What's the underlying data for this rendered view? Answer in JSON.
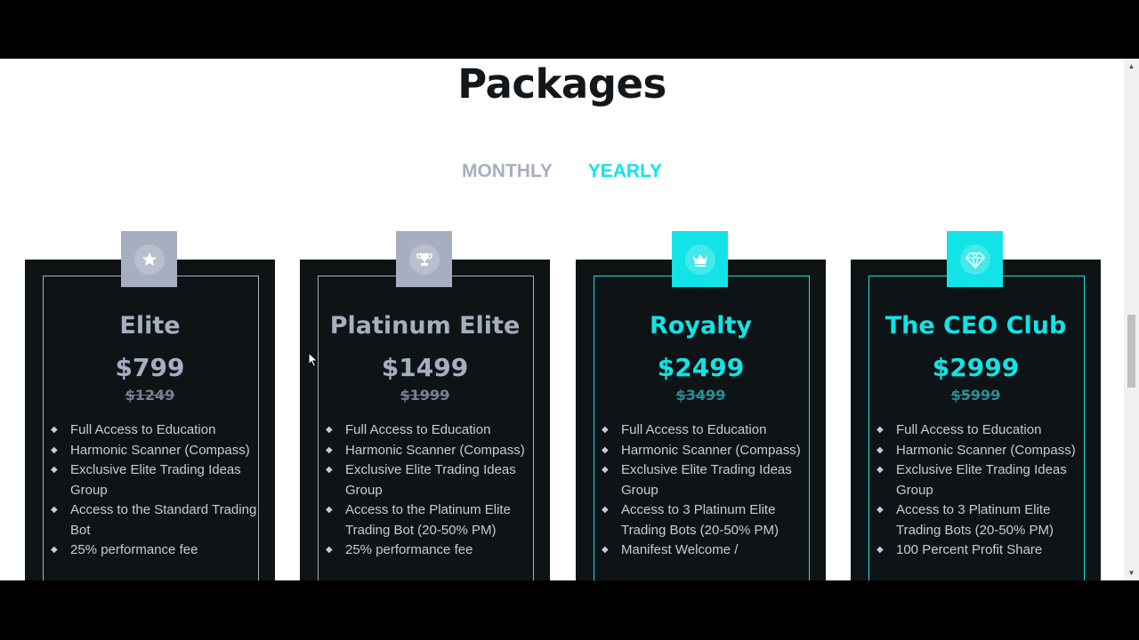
{
  "page": {
    "title": "Packages"
  },
  "billing_toggle": {
    "monthly": "MONTHLY",
    "yearly": "YEARLY",
    "selected": "yearly"
  },
  "colors": {
    "accent": "#11e3e6",
    "muted": "#a7aec0",
    "card_bg": "#0e1416"
  },
  "plans": [
    {
      "name": "Elite",
      "price": "$799",
      "old_price": "$1249",
      "icon": "star-badge-icon",
      "features": [
        "Full Access to Education",
        "Harmonic Scanner (Compass)",
        "Exclusive Elite Trading Ideas Group",
        "Access to the Standard Trading Bot",
        "25% performance fee"
      ]
    },
    {
      "name": "Platinum Elite",
      "price": "$1499",
      "old_price": "$1999",
      "icon": "trophy-icon",
      "features": [
        "Full Access to Education",
        "Harmonic Scanner (Compass)",
        "Exclusive Elite Trading Ideas Group",
        "Access to the Platinum Elite Trading Bot (20-50% PM)",
        "25% performance fee"
      ]
    },
    {
      "name": "Royalty",
      "price": "$2499",
      "old_price": "$3499",
      "icon": "crown-icon",
      "features": [
        "Full Access to Education",
        "Harmonic Scanner (Compass)",
        "Exclusive Elite Trading Ideas Group",
        "Access to 3 Platinum Elite Trading Bots (20-50% PM)",
        "Manifest Welcome /"
      ]
    },
    {
      "name": "The CEO Club",
      "price": "$2999",
      "old_price": "$5999",
      "icon": "diamond-icon",
      "features": [
        "Full Access to Education",
        "Harmonic Scanner (Compass)",
        "Exclusive Elite Trading Ideas Group",
        "Access to 3 Platinum Elite Trading Bots (20-50% PM)",
        "100 Percent Profit Share"
      ]
    }
  ]
}
